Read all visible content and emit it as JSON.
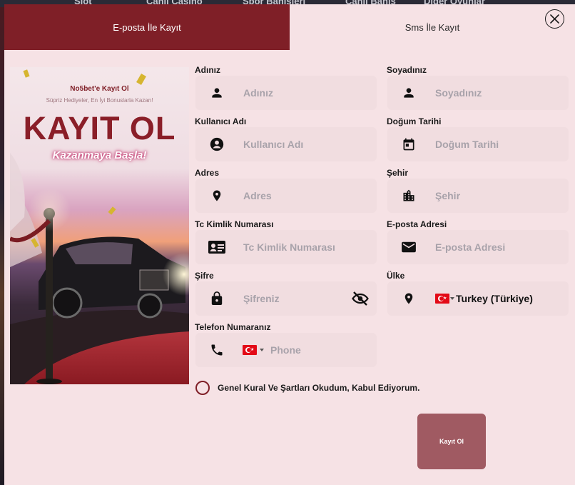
{
  "background_nav": [
    "Slot",
    "Canlı Casino",
    "Spor Bahisleri",
    "Canlı Bahis",
    "Diğer Oyunlar"
  ],
  "tabs": [
    {
      "label": "E-posta İle Kayıt",
      "active": true
    },
    {
      "label": "Sms İle Kayıt",
      "active": false
    }
  ],
  "promo": {
    "brand_line": "No5bet'e Kayıt Ol",
    "sub_line": "Süpriz Hediyeler, En İyi Bonuslarla Kazan!",
    "headline": "KAYIT OL",
    "tagline": "Kazanmaya Başla!"
  },
  "fields": {
    "first_name": {
      "label": "Adınız",
      "placeholder": "Adınız",
      "icon": "person-icon"
    },
    "last_name": {
      "label": "Soyadınız",
      "placeholder": "Soyadınız",
      "icon": "person-icon"
    },
    "username": {
      "label": "Kullanıcı Adı",
      "placeholder": "Kullanıcı Adı",
      "icon": "account-circle-icon"
    },
    "birth_date": {
      "label": "Doğum Tarihi",
      "placeholder": "Doğum Tarihi",
      "icon": "calendar-icon"
    },
    "address": {
      "label": "Adres",
      "placeholder": "Adres",
      "icon": "location-pin-icon"
    },
    "city": {
      "label": "Şehir",
      "placeholder": "Şehir",
      "icon": "city-icon"
    },
    "tc_id": {
      "label": "Tc Kimlik Numarası",
      "placeholder": "Tc Kimlik Numarası",
      "icon": "id-card-icon"
    },
    "email": {
      "label": "E-posta Adresi",
      "placeholder": "E-posta Adresi",
      "icon": "mail-icon"
    },
    "password": {
      "label": "Şifre",
      "placeholder": "Şifreniz",
      "icon": "lock-icon"
    },
    "country": {
      "label": "Ülke",
      "value": "Turkey (Türkiye)",
      "icon": "location-pin-icon"
    },
    "phone": {
      "label": "Telefon Numaranız",
      "placeholder": "Phone",
      "icon": "phone-icon"
    }
  },
  "terms_text": "Genel Kural Ve Şartları Okudum, Kabul Ediyorum.",
  "submit_label": "Kayıt Ol",
  "colors": {
    "accent": "#7f1f27",
    "modal_bg": "#f6e2e5",
    "field_bg": "#f1dde0",
    "submit_bg": "#a05a62"
  }
}
